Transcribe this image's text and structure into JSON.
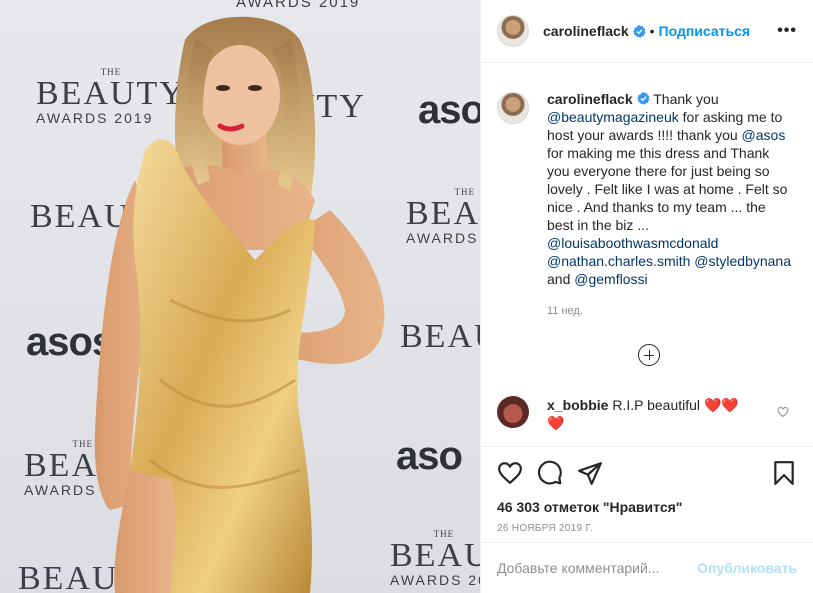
{
  "photo": {
    "backdrop": {
      "top_text": "AWARDS 2019",
      "the": "THE",
      "beauty": "BEAUTY",
      "beauty_clipped": "BEAU",
      "beauty_tail": "UTY",
      "awards": "AWARDS 2019",
      "awards_clipped": "AWARDS 201",
      "asos": "asos",
      "asos_clipped": "aso",
      "asos_edge": "as"
    }
  },
  "header": {
    "username": "carolineflack",
    "separator": "•",
    "follow_label": "Подписаться",
    "more_label": "•••"
  },
  "caption": {
    "username": "carolineflack",
    "text_1": " Thank you ",
    "mention_1": "@beautymagazineuk",
    "text_2": " for asking me to host your awards !!!! thank you ",
    "mention_2": "@asos",
    "text_3": " for making me this dress and Thank you everyone there for just being so lovely . Felt like I was at home . Felt so nice . And thanks to my team ... the best in the biz ... ",
    "mention_3": "@louisaboothwasmcdonald",
    "mention_4": "@nathan.charles.smith",
    "mention_5": "@styledbynana",
    "text_4": " and ",
    "mention_6": "@gemflossi",
    "time": "11 нед."
  },
  "comment": {
    "username": "x_bobbie",
    "text": " R.I.P beautiful ",
    "hearts": "❤️❤️❤️"
  },
  "actions": {
    "likes": "46 303 отметок \"Нравится\"",
    "date": "26 НОЯБРЯ 2019 Г."
  },
  "add_comment": {
    "placeholder": "Добавьте комментарий...",
    "publish_label": "Опубликовать"
  },
  "colors": {
    "link_blue": "#0095f6",
    "mention": "#00376b",
    "muted": "#8e8e8e",
    "publish_disabled": "#b2dffc",
    "verified": "#3897f0",
    "heart_red": "#ed4956"
  },
  "icons": [
    "verified-badge-icon",
    "more-options-icon",
    "load-more-comments-icon",
    "like-heart-icon",
    "comment-bubble-icon",
    "share-direct-icon",
    "bookmark-icon",
    "comment-like-heart-icon"
  ]
}
